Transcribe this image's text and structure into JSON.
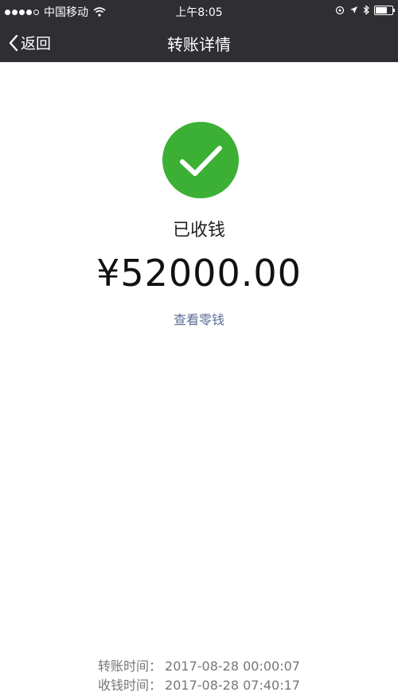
{
  "status_bar": {
    "carrier": "中国移动",
    "time": "上午8:05"
  },
  "nav": {
    "back_label": "返回",
    "title": "转账详情"
  },
  "main": {
    "status_text": "已收钱",
    "amount": "¥52000.00",
    "view_change_link": "查看零钱",
    "check_color": "#3cb035"
  },
  "details": {
    "transfer_time_label": "转账时间：",
    "transfer_time_value": "2017-08-28 00:00:07",
    "receive_time_label": "收钱时间：",
    "receive_time_value": "2017-08-28 07:40:17"
  }
}
